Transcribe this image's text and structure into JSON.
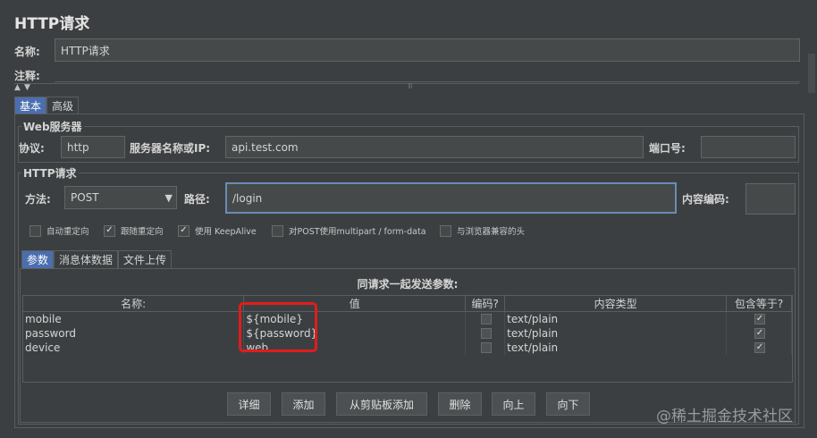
{
  "window": {
    "title": "HTTP请求"
  },
  "header": {
    "name_label": "名称:",
    "name_value": "HTTP请求",
    "comments_label": "注释:"
  },
  "main_tabs": [
    {
      "label": "基本",
      "active": true
    },
    {
      "label": "高级",
      "active": false
    }
  ],
  "web_server": {
    "legend": "Web服务器",
    "protocol_label": "协议:",
    "protocol_value": "http",
    "server_label": "服务器名称或IP:",
    "server_value": "api.test.com",
    "port_label": "端口号:",
    "port_value": ""
  },
  "http_request": {
    "legend": "HTTP请求",
    "method_label": "方法:",
    "method_value": "POST",
    "path_label": "路径:",
    "path_value": "/login",
    "encoding_label": "内容编码:",
    "encoding_value": "",
    "options": [
      {
        "label": "自动重定向",
        "checked": false
      },
      {
        "label": "跟随重定向",
        "checked": true
      },
      {
        "label": "使用 KeepAlive",
        "checked": true
      },
      {
        "label": "对POST使用multipart / form-data",
        "checked": false
      },
      {
        "label": "与浏览器兼容的头",
        "checked": false
      }
    ]
  },
  "sub_tabs": [
    {
      "label": "参数",
      "active": true
    },
    {
      "label": "消息体数据",
      "active": false
    },
    {
      "label": "文件上传",
      "active": false
    }
  ],
  "params": {
    "caption": "同请求一起发送参数:",
    "columns": [
      "名称:",
      "值",
      "编码?",
      "内容类型",
      "包含等于?"
    ],
    "rows": [
      {
        "name": "mobile",
        "value": "${mobile}",
        "encode": false,
        "content_type": "text/plain",
        "include_equals": true
      },
      {
        "name": "password",
        "value": "${password}",
        "encode": false,
        "content_type": "text/plain",
        "include_equals": true
      },
      {
        "name": "device",
        "value": "web",
        "encode": false,
        "content_type": "text/plain",
        "include_equals": true
      }
    ]
  },
  "buttons": {
    "detail": "详细",
    "add": "添加",
    "add_from_clipboard": "从剪贴板添加",
    "delete": "删除",
    "up": "向上",
    "down": "向下"
  },
  "watermark": "@稀土掘金技术社区",
  "icons": {
    "check": "✓",
    "dropdown": "▼",
    "collapse_up": "▲",
    "collapse_down": "▼",
    "grip": "⁝⁝⁝"
  }
}
